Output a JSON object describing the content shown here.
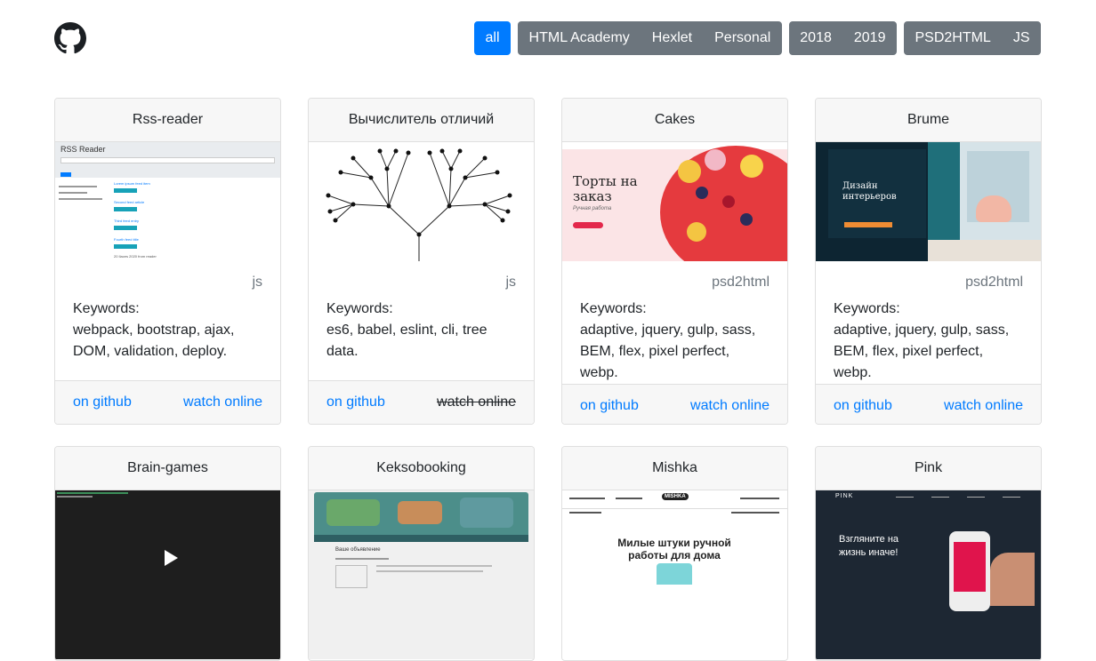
{
  "header": {
    "logo_icon": "github-icon",
    "filters": [
      {
        "group": 1,
        "items": [
          {
            "label": "all",
            "active": true
          }
        ]
      },
      {
        "group": 2,
        "items": [
          {
            "label": "HTML Academy"
          },
          {
            "label": "Hexlet"
          },
          {
            "label": "Personal"
          }
        ]
      },
      {
        "group": 3,
        "items": [
          {
            "label": "2018"
          },
          {
            "label": "2019"
          }
        ]
      },
      {
        "group": 4,
        "items": [
          {
            "label": "PSD2HTML"
          },
          {
            "label": "JS"
          }
        ]
      }
    ]
  },
  "colors": {
    "accent": "#007bff",
    "filter_bg": "#6c757d",
    "card_header_bg": "#f7f7f7"
  },
  "cards": [
    {
      "title": "Rss-reader",
      "tag": "js",
      "keywords_label": "Keywords:",
      "keywords": "webpack, bootstrap, ajax, DOM, validation, deploy.",
      "github_label": "on github",
      "online_label": "watch online",
      "thumb": {
        "title": "RSS Reader",
        "lines": [
          "Lorem ipsum feed item",
          "Second feed article",
          "Third feed entry",
          "Fourth feed title"
        ],
        "footer": "20 Ilaces 2020 from reader"
      }
    },
    {
      "title": "Вычислитель отличий",
      "tag": "js",
      "keywords_label": "Keywords:",
      "keywords": "es6, babel, eslint, cli, tree data.",
      "github_label": "on github",
      "online_label": "watch online",
      "online_disabled": true
    },
    {
      "title": "Cakes",
      "tag": "psd2html",
      "keywords_label": "Keywords:",
      "keywords": "adaptive, jquery, gulp, sass, BEM, flex, pixel perfect, webp.",
      "github_label": "on github",
      "online_label": "watch online",
      "thumb": {
        "headline": "Торты на заказ",
        "sub": "Ручная работа"
      }
    },
    {
      "title": "Brume",
      "tag": "psd2html",
      "keywords_label": "Keywords:",
      "keywords": "adaptive, jquery, gulp, sass, BEM, flex, pixel perfect, webp.",
      "github_label": "on github",
      "online_label": "watch online",
      "thumb": {
        "headline": "Дизайн интерьеров"
      }
    },
    {
      "title": "Brain-games"
    },
    {
      "title": "Keksobooking",
      "thumb": {
        "headline": "Ваше объявление"
      }
    },
    {
      "title": "Mishka",
      "thumb": {
        "logo": "MISHKA",
        "headline": "Милые штуки ручной работы для дома"
      }
    },
    {
      "title": "Pink",
      "thumb": {
        "logo": "PINK",
        "headline": "Взгляните на жизнь иначе!"
      }
    }
  ]
}
